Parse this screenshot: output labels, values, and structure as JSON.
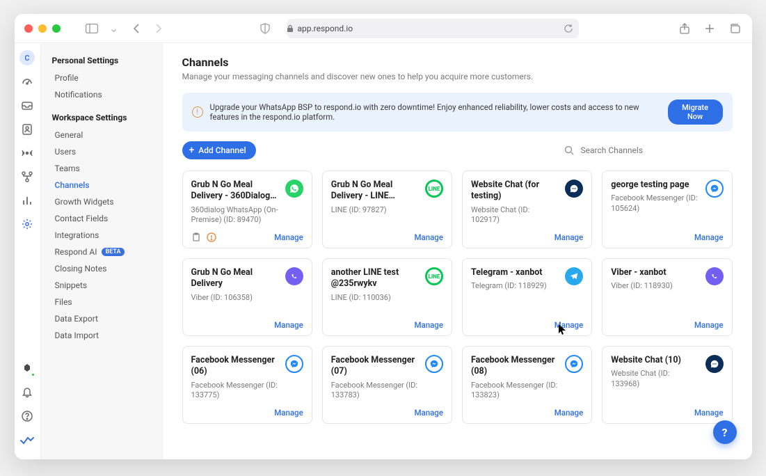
{
  "chrome": {
    "url_host": "app.respond.io"
  },
  "rail": {
    "avatar_initial": "C"
  },
  "sidebar": {
    "group1_title": "Personal Settings",
    "group1_items": [
      "Profile",
      "Notifications"
    ],
    "group2_title": "Workspace Settings",
    "group2_items": [
      "General",
      "Users",
      "Teams",
      "Channels",
      "Growth Widgets",
      "Contact Fields",
      "Integrations",
      "Respond AI",
      "Closing Notes",
      "Snippets",
      "Files",
      "Data Export",
      "Data Import"
    ],
    "active_item": "Channels",
    "beta_label": "BETA"
  },
  "page": {
    "title": "Channels",
    "subtitle": "Manage your messaging channels and discover new ones to help you acquire more customers."
  },
  "banner": {
    "text": "Upgrade your WhatsApp BSP to respond.io with zero downtime! Enjoy enhanced reliability, lower costs and access to new features in the respond.io platform.",
    "cta": "Migrate Now"
  },
  "toolbar": {
    "add_label": "Add Channel",
    "search_placeholder": "Search Channels"
  },
  "manage_label": "Manage",
  "line_badge": "LINE",
  "channels": [
    {
      "title": "Grub N Go Meal Delivery - 360Dialog…",
      "sub": "360dialog WhatsApp (On-Premise) (ID: 89470)",
      "icon": "whatsapp",
      "warn": true
    },
    {
      "title": "Grub N Go Meal Delivery - LINE…",
      "sub": "LINE (ID: 97827)",
      "icon": "line"
    },
    {
      "title": "Website Chat (for testing)",
      "sub": "Website Chat (ID: 102917)",
      "icon": "webchat"
    },
    {
      "title": "george testing page",
      "sub": "Facebook Messenger (ID: 105624)",
      "icon": "messenger"
    },
    {
      "title": "Grub N Go Meal Delivery",
      "sub": "Viber (ID: 106358)",
      "icon": "viber"
    },
    {
      "title": "another LINE test @235rwykv",
      "sub": "LINE (ID: 110036)",
      "icon": "line"
    },
    {
      "title": "Telegram - xanbot",
      "sub": "Telegram (ID: 118929)",
      "icon": "telegram"
    },
    {
      "title": "Viber - xanbot",
      "sub": "Viber (ID: 118930)",
      "icon": "viber"
    },
    {
      "title": "Facebook Messenger (06)",
      "sub": "Facebook Messenger (ID: 133775)",
      "icon": "messenger"
    },
    {
      "title": "Facebook Messenger (07)",
      "sub": "Facebook Messenger (ID: 133783)",
      "icon": "messenger"
    },
    {
      "title": "Facebook Messenger (08)",
      "sub": "Facebook Messenger (ID: 133823)",
      "icon": "messenger"
    },
    {
      "title": "Website Chat (10)",
      "sub": "Website Chat (ID: 133968)",
      "icon": "webchat"
    }
  ]
}
